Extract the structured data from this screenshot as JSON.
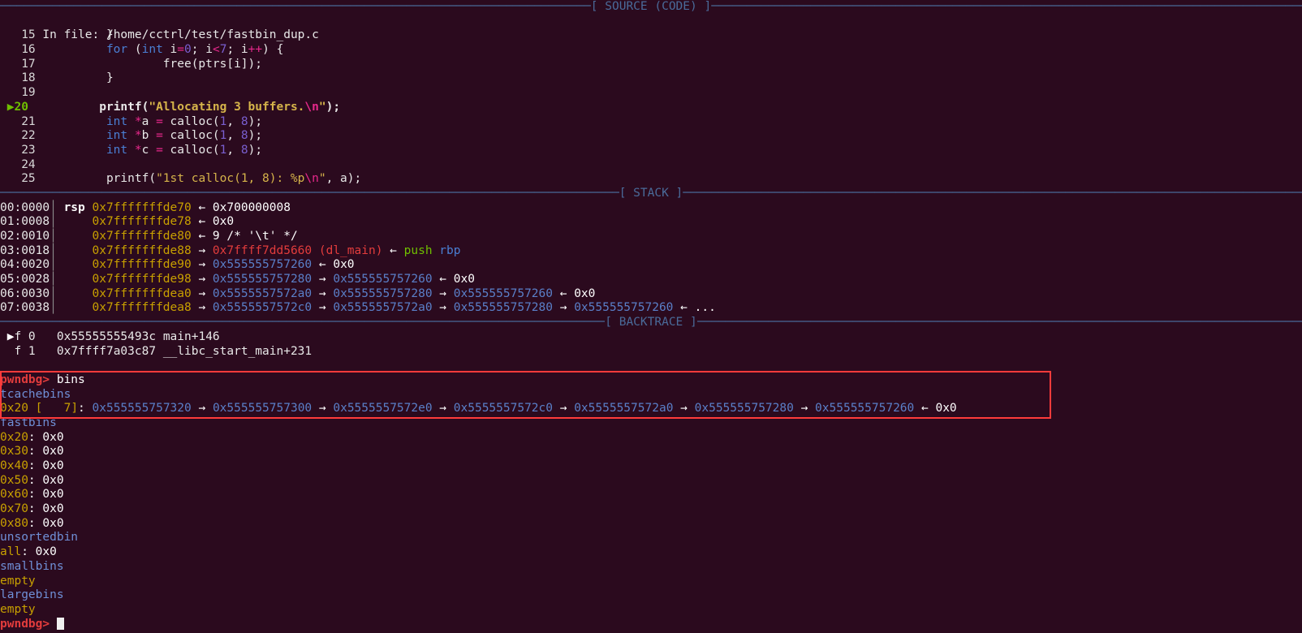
{
  "sections": {
    "source_label": "[ SOURCE (CODE) ]",
    "stack_label": "[ STACK ]",
    "backtrace_label": "[ BACKTRACE ]"
  },
  "source": {
    "file_prefix": "In file: ",
    "file_path": "/home/cctrl/test/fastbin_dup.c",
    "current_line": 20,
    "arrow_glyph": "▶",
    "lines": [
      {
        "n": "15",
        "segs": [
          {
            "t": "        }",
            "c": "pl"
          }
        ]
      },
      {
        "n": "16",
        "segs": [
          {
            "t": "        ",
            "c": "pl"
          },
          {
            "t": "for",
            "c": "kw"
          },
          {
            "t": " (",
            "c": "pl"
          },
          {
            "t": "int",
            "c": "kw"
          },
          {
            "t": " i",
            "c": "pl"
          },
          {
            "t": "=",
            "c": "op"
          },
          {
            "t": "0",
            "c": "num"
          },
          {
            "t": "; i",
            "c": "pl"
          },
          {
            "t": "<",
            "c": "op"
          },
          {
            "t": "7",
            "c": "num"
          },
          {
            "t": "; i",
            "c": "pl"
          },
          {
            "t": "++",
            "c": "op"
          },
          {
            "t": ") {",
            "c": "pl"
          }
        ]
      },
      {
        "n": "17",
        "segs": [
          {
            "t": "                free(ptrs[i]);",
            "c": "pl"
          }
        ]
      },
      {
        "n": "18",
        "segs": [
          {
            "t": "        }",
            "c": "pl"
          }
        ]
      },
      {
        "n": "19",
        "segs": [
          {
            "t": "",
            "c": "pl"
          }
        ]
      },
      {
        "n": "20",
        "cur": true,
        "segs": [
          {
            "t": "        printf(",
            "c": "pl"
          },
          {
            "t": "\"Allocating 3 buffers.",
            "c": "str"
          },
          {
            "t": "\\n",
            "c": "esc"
          },
          {
            "t": "\"",
            "c": "str"
          },
          {
            "t": ");",
            "c": "pl"
          }
        ]
      },
      {
        "n": "21",
        "segs": [
          {
            "t": "        ",
            "c": "pl"
          },
          {
            "t": "int",
            "c": "kw"
          },
          {
            "t": " ",
            "c": "pl"
          },
          {
            "t": "*",
            "c": "op"
          },
          {
            "t": "a ",
            "c": "pl"
          },
          {
            "t": "=",
            "c": "op"
          },
          {
            "t": " calloc(",
            "c": "pl"
          },
          {
            "t": "1",
            "c": "num"
          },
          {
            "t": ", ",
            "c": "pl"
          },
          {
            "t": "8",
            "c": "num"
          },
          {
            "t": ");",
            "c": "pl"
          }
        ]
      },
      {
        "n": "22",
        "segs": [
          {
            "t": "        ",
            "c": "pl"
          },
          {
            "t": "int",
            "c": "kw"
          },
          {
            "t": " ",
            "c": "pl"
          },
          {
            "t": "*",
            "c": "op"
          },
          {
            "t": "b ",
            "c": "pl"
          },
          {
            "t": "=",
            "c": "op"
          },
          {
            "t": " calloc(",
            "c": "pl"
          },
          {
            "t": "1",
            "c": "num"
          },
          {
            "t": ", ",
            "c": "pl"
          },
          {
            "t": "8",
            "c": "num"
          },
          {
            "t": ");",
            "c": "pl"
          }
        ]
      },
      {
        "n": "23",
        "segs": [
          {
            "t": "        ",
            "c": "pl"
          },
          {
            "t": "int",
            "c": "kw"
          },
          {
            "t": " ",
            "c": "pl"
          },
          {
            "t": "*",
            "c": "op"
          },
          {
            "t": "c ",
            "c": "pl"
          },
          {
            "t": "=",
            "c": "op"
          },
          {
            "t": " calloc(",
            "c": "pl"
          },
          {
            "t": "1",
            "c": "num"
          },
          {
            "t": ", ",
            "c": "pl"
          },
          {
            "t": "8",
            "c": "num"
          },
          {
            "t": ");",
            "c": "pl"
          }
        ]
      },
      {
        "n": "24",
        "segs": [
          {
            "t": "",
            "c": "pl"
          }
        ]
      },
      {
        "n": "25",
        "segs": [
          {
            "t": "        printf(",
            "c": "pl"
          },
          {
            "t": "\"1st calloc(1, 8): %p",
            "c": "str"
          },
          {
            "t": "\\n",
            "c": "esc"
          },
          {
            "t": "\"",
            "c": "str"
          },
          {
            "t": ", a);",
            "c": "pl"
          }
        ]
      }
    ]
  },
  "stack": {
    "rows": [
      {
        "off": "00:0000",
        "reg": "rsp",
        "segs": [
          {
            "t": "0x7fffffffde70",
            "c": "addr-stack"
          },
          {
            "t": " ← ",
            "c": "ar"
          },
          {
            "t": "0x700000008",
            "c": "val"
          }
        ]
      },
      {
        "off": "01:0008",
        "reg": "",
        "segs": [
          {
            "t": "0x7fffffffde78",
            "c": "addr-stack"
          },
          {
            "t": " ← ",
            "c": "ar"
          },
          {
            "t": "0x0",
            "c": "val"
          }
        ]
      },
      {
        "off": "02:0010",
        "reg": "",
        "segs": [
          {
            "t": "0x7fffffffde80",
            "c": "addr-stack"
          },
          {
            "t": " ← ",
            "c": "ar"
          },
          {
            "t": "9 /* '\\t' */",
            "c": "val"
          }
        ]
      },
      {
        "off": "03:0018",
        "reg": "",
        "segs": [
          {
            "t": "0x7fffffffde88",
            "c": "addr-stack"
          },
          {
            "t": " → ",
            "c": "ar"
          },
          {
            "t": "0x7ffff7dd5660 (dl_main)",
            "c": "addr-code"
          },
          {
            "t": " ← ",
            "c": "ar"
          },
          {
            "t": "push ",
            "c": "asm-m"
          },
          {
            "t": "rbp",
            "c": "asm-r"
          }
        ]
      },
      {
        "off": "04:0020",
        "reg": "",
        "segs": [
          {
            "t": "0x7fffffffde90",
            "c": "addr-stack"
          },
          {
            "t": " → ",
            "c": "ar"
          },
          {
            "t": "0x555555757260",
            "c": "addr-heap"
          },
          {
            "t": " ← ",
            "c": "ar"
          },
          {
            "t": "0x0",
            "c": "val"
          }
        ]
      },
      {
        "off": "05:0028",
        "reg": "",
        "segs": [
          {
            "t": "0x7fffffffde98",
            "c": "addr-stack"
          },
          {
            "t": " → ",
            "c": "ar"
          },
          {
            "t": "0x555555757280",
            "c": "addr-heap"
          },
          {
            "t": " → ",
            "c": "ar"
          },
          {
            "t": "0x555555757260",
            "c": "addr-heap"
          },
          {
            "t": " ← ",
            "c": "ar"
          },
          {
            "t": "0x0",
            "c": "val"
          }
        ]
      },
      {
        "off": "06:0030",
        "reg": "",
        "segs": [
          {
            "t": "0x7fffffffdea0",
            "c": "addr-stack"
          },
          {
            "t": " → ",
            "c": "ar"
          },
          {
            "t": "0x5555557572a0",
            "c": "addr-heap"
          },
          {
            "t": " → ",
            "c": "ar"
          },
          {
            "t": "0x555555757280",
            "c": "addr-heap"
          },
          {
            "t": " → ",
            "c": "ar"
          },
          {
            "t": "0x555555757260",
            "c": "addr-heap"
          },
          {
            "t": " ← ",
            "c": "ar"
          },
          {
            "t": "0x0",
            "c": "val"
          }
        ]
      },
      {
        "off": "07:0038",
        "reg": "",
        "segs": [
          {
            "t": "0x7fffffffdea8",
            "c": "addr-stack"
          },
          {
            "t": " → ",
            "c": "ar"
          },
          {
            "t": "0x5555557572c0",
            "c": "addr-heap"
          },
          {
            "t": " → ",
            "c": "ar"
          },
          {
            "t": "0x5555557572a0",
            "c": "addr-heap"
          },
          {
            "t": " → ",
            "c": "ar"
          },
          {
            "t": "0x555555757280",
            "c": "addr-heap"
          },
          {
            "t": " → ",
            "c": "ar"
          },
          {
            "t": "0x555555757260",
            "c": "addr-heap"
          },
          {
            "t": " ← ",
            "c": "ar"
          },
          {
            "t": "...",
            "c": "val"
          }
        ]
      }
    ]
  },
  "backtrace": {
    "marker_glyph": "▶",
    "frames": [
      {
        "marker": true,
        "id": "f 0",
        "addr": "0x55555555493c",
        "sym": "main+146"
      },
      {
        "marker": false,
        "id": "f 1",
        "addr": "0x7ffff7a03c87",
        "sym": "__libc_start_main+231"
      }
    ]
  },
  "console": {
    "prompt": "pwndbg>",
    "command": "bins",
    "highlight_color": "#ff3b3b",
    "tcachebins": {
      "header": "tcachebins",
      "size": "0x20",
      "count": "7",
      "chain": [
        "0x555555757320",
        "0x555555757300",
        "0x5555557572e0",
        "0x5555557572c0",
        "0x5555557572a0",
        "0x555555757280",
        "0x555555757260"
      ],
      "tail": "0x0"
    },
    "fastbins": {
      "header": "fastbins",
      "rows": [
        {
          "size": "0x20",
          "value": "0x0"
        },
        {
          "size": "0x30",
          "value": "0x0"
        },
        {
          "size": "0x40",
          "value": "0x0"
        },
        {
          "size": "0x50",
          "value": "0x0"
        },
        {
          "size": "0x60",
          "value": "0x0"
        },
        {
          "size": "0x70",
          "value": "0x0"
        },
        {
          "size": "0x80",
          "value": "0x0"
        }
      ]
    },
    "unsortedbin": {
      "header": "unsortedbin",
      "rows": [
        {
          "size": "all",
          "value": "0x0"
        }
      ]
    },
    "smallbins": {
      "header": "smallbins",
      "empty_text": "empty"
    },
    "largebins": {
      "header": "largebins",
      "empty_text": "empty"
    },
    "final_prompt": "pwndbg>"
  }
}
